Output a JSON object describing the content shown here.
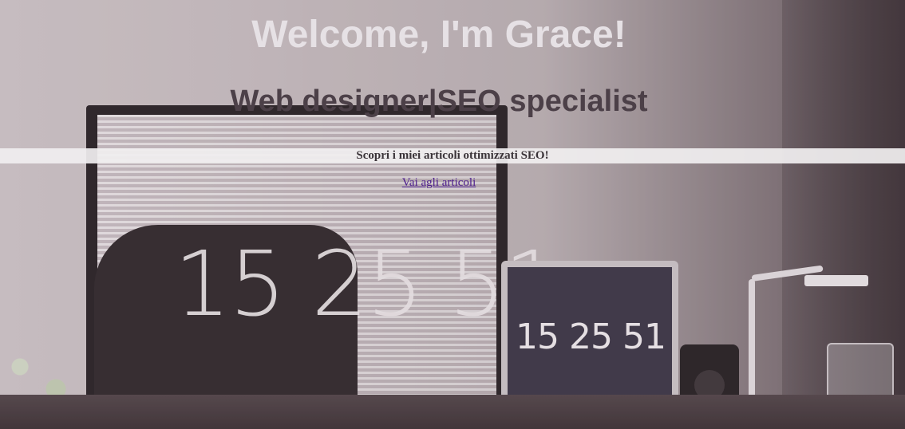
{
  "hero": {
    "title": "Welcome, I'm Grace!",
    "subtitle": "Web designer|SEO specialist",
    "banner_text": "Scopri i miei articoli ottimizzati SEO!",
    "link_text": "Vai agli articoli",
    "background_image": {
      "monitor_clock": "15 25 51",
      "laptop_clock": "15 25 51"
    }
  },
  "colors": {
    "title": "#e6e1e5",
    "subtitle": "#4c4048",
    "banner_bg": "#f0eeef",
    "banner_text": "#3a3338",
    "link": "#4b1b8c"
  }
}
